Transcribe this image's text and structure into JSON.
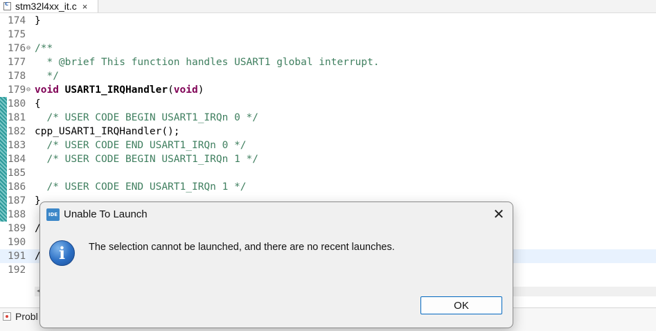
{
  "editor_tab": {
    "label": "stm32l4xx_it.c",
    "close": "×"
  },
  "code_lines": [
    {
      "num": "174",
      "text": "}"
    },
    {
      "num": "175",
      "text": ""
    },
    {
      "num": "176",
      "fold": "⊖",
      "text": "/**"
    },
    {
      "num": "177",
      "text": "  * @brief This function handles USART1 global interrupt."
    },
    {
      "num": "178",
      "text": "  */"
    },
    {
      "num": "179",
      "fold": "⊖",
      "kw1": "void",
      "fn": "USART1_IRQHandler",
      "p1": "(",
      "kw2": "void",
      "p2": ")"
    },
    {
      "num": "180",
      "text": "{"
    },
    {
      "num": "181",
      "text": "  /* USER CODE BEGIN USART1_IRQn 0 */"
    },
    {
      "num": "182",
      "text": "cpp_USART1_IRQHandler();"
    },
    {
      "num": "183",
      "text": "  /* USER CODE END USART1_IRQn 0 */"
    },
    {
      "num": "184",
      "text": "  /* USER CODE BEGIN USART1_IRQn 1 */"
    },
    {
      "num": "185",
      "text": ""
    },
    {
      "num": "186",
      "text": "  /* USER CODE END USART1_IRQn 1 */"
    },
    {
      "num": "187",
      "text": "}"
    },
    {
      "num": "188",
      "text": ""
    },
    {
      "num": "189",
      "text": "/"
    },
    {
      "num": "190",
      "text": ""
    },
    {
      "num": "191",
      "text": "/"
    },
    {
      "num": "192",
      "text": ""
    }
  ],
  "bottom_panel": {
    "tab_label": "Probl"
  },
  "dialog": {
    "title": "Unable To Launch",
    "app_icon": "IDE",
    "close": "✕",
    "info_glyph": "i",
    "message": "The selection cannot be launched, and there are no recent launches.",
    "ok_label": "OK"
  }
}
